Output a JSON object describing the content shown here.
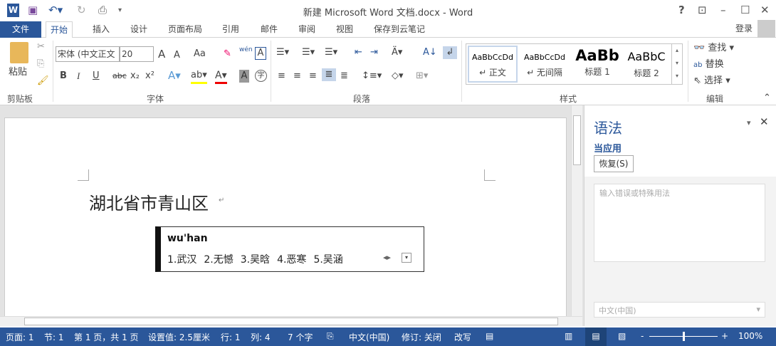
{
  "title": "新建 Microsoft Word 文档.docx - Word",
  "quick_access": {
    "help": "?",
    "signin": "登录"
  },
  "tabs": [
    "文件",
    "开始",
    "插入",
    "设计",
    "页面布局",
    "引用",
    "邮件",
    "审阅",
    "视图",
    "保存到云笔记"
  ],
  "ribbon": {
    "clipboard": {
      "paste": "粘贴",
      "label": "剪贴板"
    },
    "font": {
      "font_name": "宋体 (中文正文",
      "font_size": "20",
      "label": "字体",
      "grow": "A",
      "shrink": "A",
      "case": "Aa",
      "phonetic": "wén",
      "bold": "B",
      "italic": "I",
      "underline": "U",
      "strike": "abc",
      "sub": "x₂",
      "sup": "x²",
      "enclose": "字"
    },
    "paragraph": {
      "label": "段落"
    },
    "styles": {
      "label": "样式",
      "items": [
        {
          "preview": "AaBbCcDd",
          "name": "↵ 正文"
        },
        {
          "preview": "AaBbCcDd",
          "name": "↵ 无间隔"
        },
        {
          "preview": "AaBb",
          "name": "标题 1"
        },
        {
          "preview": "AaBbC",
          "name": "标题 2"
        }
      ]
    },
    "editing": {
      "label": "编辑",
      "find": "查找",
      "replace": "替换",
      "select": "选择"
    }
  },
  "document": {
    "text": "湖北省市青山区",
    "para_mark": "↵"
  },
  "ime": {
    "input": "wu'han",
    "candidates": [
      "1.武汉",
      "2.无憾",
      "3.吴晗",
      "4.恶寒",
      "5.吴涵"
    ]
  },
  "pane": {
    "title": "语法",
    "subtitle": "当应用",
    "resume_button": "恢复(S)",
    "input_placeholder": "输入错误或特殊用法",
    "language": "中文(中国)"
  },
  "status": {
    "page": "页面: 1",
    "section": "节: 1",
    "pages": "第 1 页，共 1 页",
    "position": "设置值: 2.5厘米",
    "line": "行: 1",
    "column": "列: 4",
    "words": "7 个字",
    "language": "中文(中国)",
    "track": "修订: 关闭",
    "overtype": "改写",
    "zoom": "100%",
    "zoom_percent": 100
  },
  "colors": {
    "accent": "#2b579a"
  }
}
